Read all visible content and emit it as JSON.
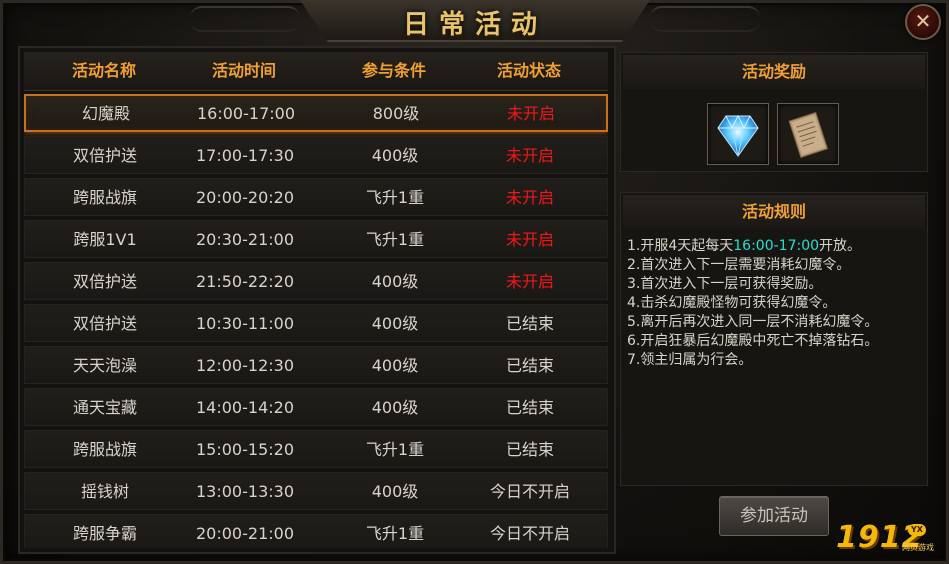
{
  "window": {
    "title": "日常活动",
    "close_label": "✕"
  },
  "table": {
    "headers": [
      "活动名称",
      "活动时间",
      "参与条件",
      "活动状态"
    ],
    "rows": [
      {
        "name": "幻魔殿",
        "time": "16:00-17:00",
        "condition": "800级",
        "status": "未开启",
        "status_color": "#f01818",
        "selected": true
      },
      {
        "name": "双倍护送",
        "time": "17:00-17:30",
        "condition": "400级",
        "status": "未开启",
        "status_color": "#f01818"
      },
      {
        "name": "跨服战旗",
        "time": "20:00-20:20",
        "condition": "飞升1重",
        "status": "未开启",
        "status_color": "#f01818"
      },
      {
        "name": "跨服1V1",
        "time": "20:30-21:00",
        "condition": "飞升1重",
        "status": "未开启",
        "status_color": "#f01818"
      },
      {
        "name": "双倍护送",
        "time": "21:50-22:20",
        "condition": "400级",
        "status": "未开启",
        "status_color": "#f01818"
      },
      {
        "name": "双倍护送",
        "time": "10:30-11:00",
        "condition": "400级",
        "status": "已结束",
        "status_color": "#d8d4c8"
      },
      {
        "name": "天天泡澡",
        "time": "12:00-12:30",
        "condition": "400级",
        "status": "已结束",
        "status_color": "#d8d4c8"
      },
      {
        "name": "通天宝藏",
        "time": "14:00-14:20",
        "condition": "400级",
        "status": "已结束",
        "status_color": "#d8d4c8"
      },
      {
        "name": "跨服战旗",
        "time": "15:00-15:20",
        "condition": "飞升1重",
        "status": "已结束",
        "status_color": "#d8d4c8"
      },
      {
        "name": "摇钱树",
        "time": "13:00-13:30",
        "condition": "400级",
        "status": "今日不开启",
        "status_color": "#d8d4c8"
      },
      {
        "name": "跨服争霸",
        "time": "20:00-21:00",
        "condition": "飞升1重",
        "status": "今日不开启",
        "status_color": "#d8d4c8"
      }
    ]
  },
  "reward": {
    "title": "活动奖励",
    "items": [
      {
        "icon": "blue-diamond-icon"
      },
      {
        "icon": "scroll-icon"
      }
    ]
  },
  "rules": {
    "title": "活动规则",
    "line1_pre": "1.开服4天起每天",
    "line1_hl": "16:00-17:00",
    "line1_post": "开放。",
    "lines": [
      "2.首次进入下一层需要消耗幻魔令。",
      "3.首次进入下一层可获得奖励。",
      "4.击杀幻魔殿怪物可获得幻魔令。",
      "5.离开后再次进入同一层不消耗幻魔令。",
      "6.开启狂暴后幻魔殿中死亡不掉落钻石。",
      "7.领主归属为行会。"
    ],
    "highlight_color": "#22e0d0"
  },
  "join_button": "参加活动",
  "logo": {
    "number": "1912",
    "badge": "YX",
    "sub": "网页游戏"
  }
}
